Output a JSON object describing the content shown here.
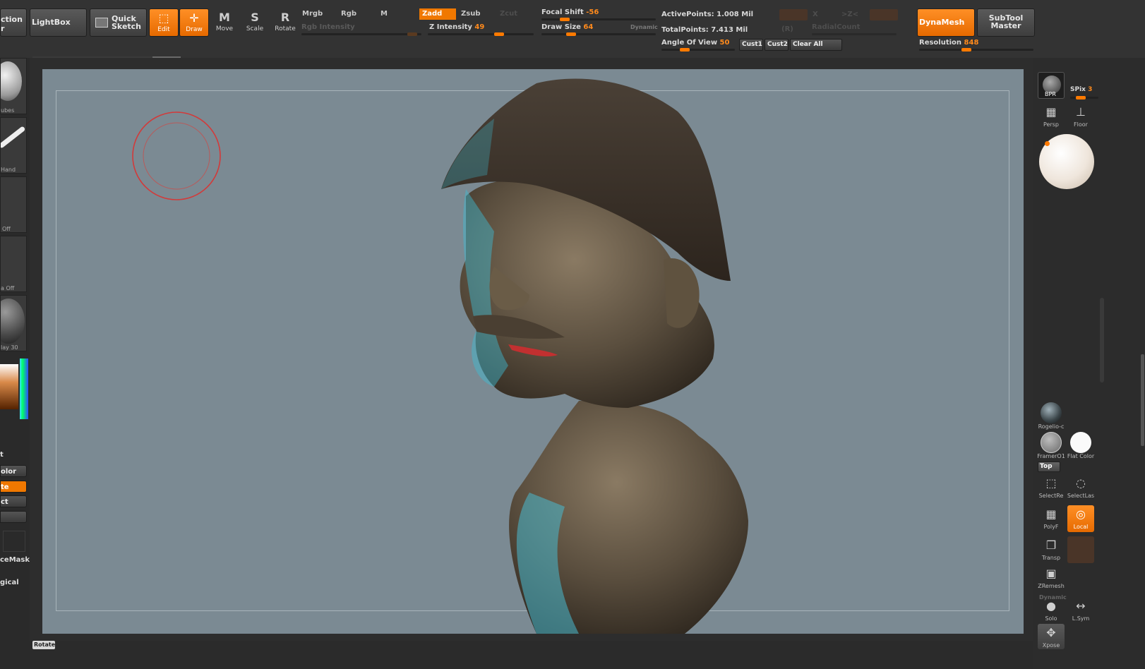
{
  "topbar": {
    "projection_label_1": "ction",
    "projection_label_2": "r",
    "lightbox": "LightBox",
    "quicksketch_1": "Quick",
    "quicksketch_2": "Sketch",
    "tools": [
      {
        "label": "Edit",
        "glyph": "⬚"
      },
      {
        "label": "Draw",
        "glyph": "✛"
      },
      {
        "label": "Move",
        "glyph": "M"
      },
      {
        "label": "Scale",
        "glyph": "S"
      },
      {
        "label": "Rotate",
        "glyph": "R"
      }
    ],
    "mrgb": "Mrgb",
    "rgb": "Rgb",
    "m": "M",
    "zadd": "Zadd",
    "zsub": "Zsub",
    "zcut": "Zcut",
    "rgb_intensity": "Rgb Intensity",
    "z_intensity_label": "Z Intensity",
    "z_intensity_value": "49",
    "focal_shift_label": "Focal Shift",
    "focal_shift_value": "-56",
    "draw_size_label": "Draw Size",
    "draw_size_value": "64",
    "dynamic": "Dynamic",
    "active_points": "ActivePoints: 1.008 Mil",
    "total_points": "TotalPoints: 7.413 Mil",
    "angle_of_view_label": "Angle Of View",
    "angle_of_view_value": "50",
    "cust1": "Cust1",
    "cust2": "Cust2",
    "clear_all": "Clear All",
    "sym_x": "X",
    "sym_y": "Y",
    "sym_z": ">Z<",
    "sym_m": "(R)",
    "radial_count": "RadialCount",
    "dynamesh": "DynaMesh",
    "subtool_master_1": "SubTool",
    "subtool_master_2": "Master",
    "resolution_label": "Resolution",
    "resolution_value": "848"
  },
  "left": {
    "thumb1": "ubes",
    "thumb2": "Hand",
    "thumb3": "Off",
    "thumb4": "a  Off",
    "thumb5": "lay  30",
    "text_t": "t",
    "bar_color": "olor",
    "bar_te": "te",
    "bar_ct": "ct",
    "cemask": "ceMask",
    "gical": "gical"
  },
  "bottom": {
    "rotate_button": "Rotate"
  },
  "right": {
    "bpr": "BPR",
    "spix_label": "SPix",
    "spix_value": "3",
    "persp": "Persp",
    "floor": "Floor",
    "material": "Rogelio-c",
    "framer": "FramerO1",
    "flat": "Flat",
    "color": "Color",
    "top": "Top",
    "selectrect": "SelectRe",
    "selectlasso": "SelectLas",
    "polyf": "PolyF",
    "local": "Local",
    "transp": "Transp",
    "zremesher": "ZRemesh",
    "dynamic": "Dynamic",
    "solo": "Solo",
    "lsym": "L.Sym",
    "xpose": "Xpose"
  },
  "colors": {
    "accent": "#f07800",
    "canvas_bg": "#7b8a93",
    "brush_ring": "#d23a3a"
  }
}
